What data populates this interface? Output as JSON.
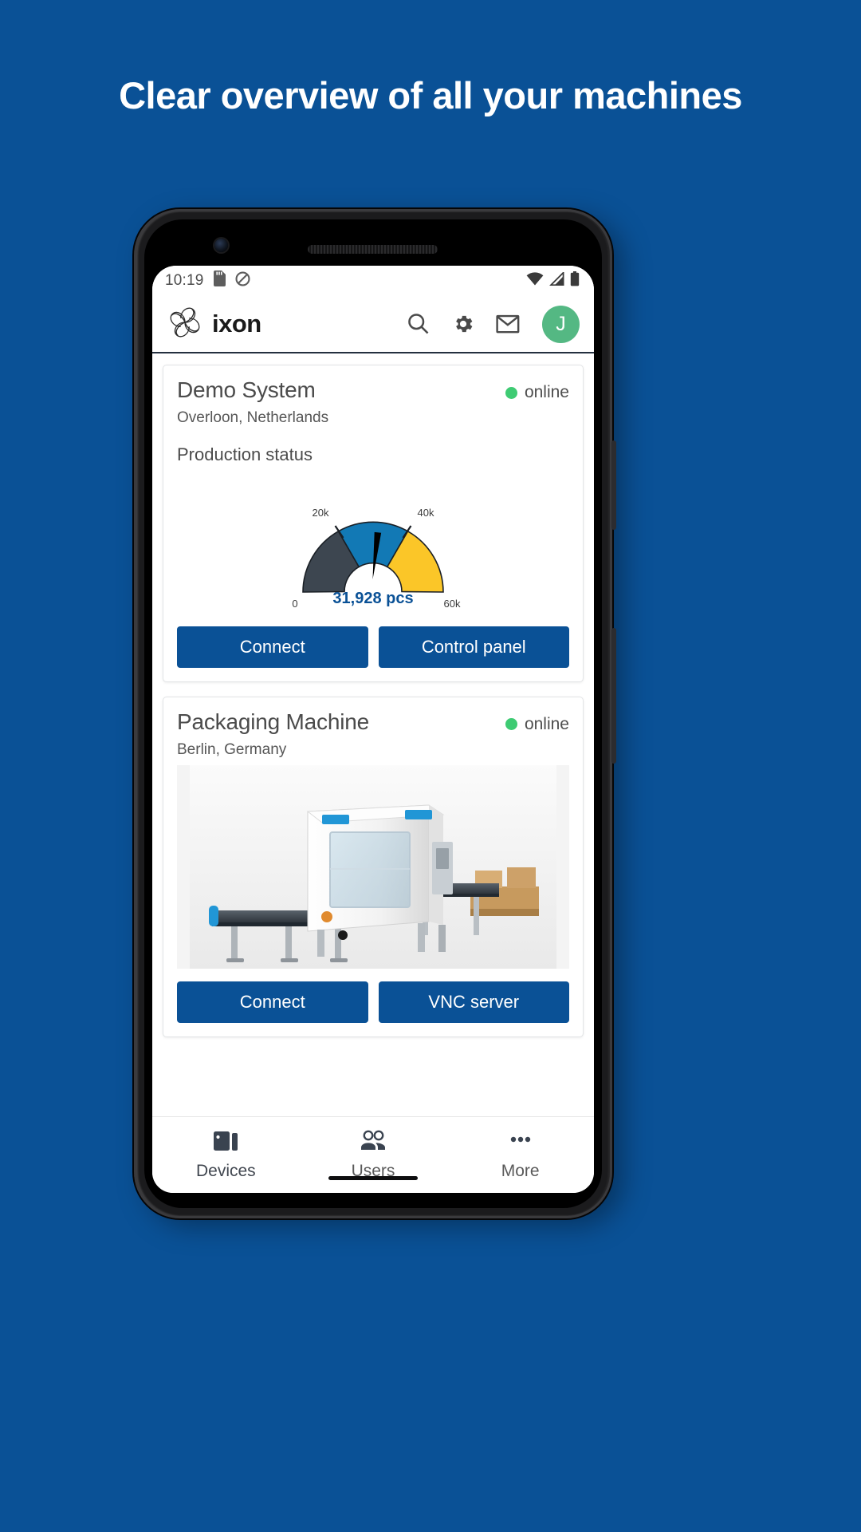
{
  "hero": {
    "title": "Clear overview of all your machines",
    "background_color": "#0a5196"
  },
  "phone": {
    "status_bar": {
      "time": "10:19",
      "icons": [
        "sd-card-icon",
        "do-not-disturb-icon"
      ],
      "right_icons": [
        "wifi-icon",
        "cellular-signal-icon",
        "battery-icon"
      ]
    },
    "app_bar": {
      "brand_name": "ixon",
      "logo": "ixon-logo-icon",
      "actions": [
        "search-icon",
        "gear-icon",
        "mail-icon"
      ],
      "avatar_initial": "J",
      "avatar_color": "#54b883"
    },
    "devices": [
      {
        "name": "Demo System",
        "location": "Overloon, Netherlands",
        "status": "online",
        "status_color": "#3ecb73",
        "section_label": "Production status",
        "widget": "gauge",
        "buttons": [
          "Connect",
          "Control panel"
        ]
      },
      {
        "name": "Packaging Machine",
        "location": "Berlin, Germany",
        "status": "online",
        "status_color": "#3ecb73",
        "widget": "machine-photo",
        "buttons": [
          "Connect",
          "VNC server"
        ]
      }
    ],
    "bottom_nav": [
      {
        "label": "Devices",
        "icon": "devices-icon",
        "active": true
      },
      {
        "label": "Users",
        "icon": "users-icon",
        "active": false
      },
      {
        "label": "More",
        "icon": "more-dots-icon",
        "active": false
      }
    ]
  },
  "chart_data": {
    "type": "gauge",
    "title": "Production status",
    "value": 31928,
    "value_label": "31,928 pcs",
    "unit": "pcs",
    "min": 0,
    "max": 60000,
    "tick_labels": [
      "0",
      "20k",
      "40k",
      "60k"
    ],
    "tick_values": [
      0,
      20000,
      40000,
      60000
    ],
    "bands": [
      {
        "from": 0,
        "to": 20000,
        "color": "#3d4650",
        "label": "0-20k"
      },
      {
        "from": 20000,
        "to": 40000,
        "color": "#1279b5",
        "label": "20k-40k"
      },
      {
        "from": 40000,
        "to": 60000,
        "color": "#fbc628",
        "label": "40k-60k"
      }
    ],
    "needle_color": "#000000",
    "value_color": "#0a5196"
  }
}
